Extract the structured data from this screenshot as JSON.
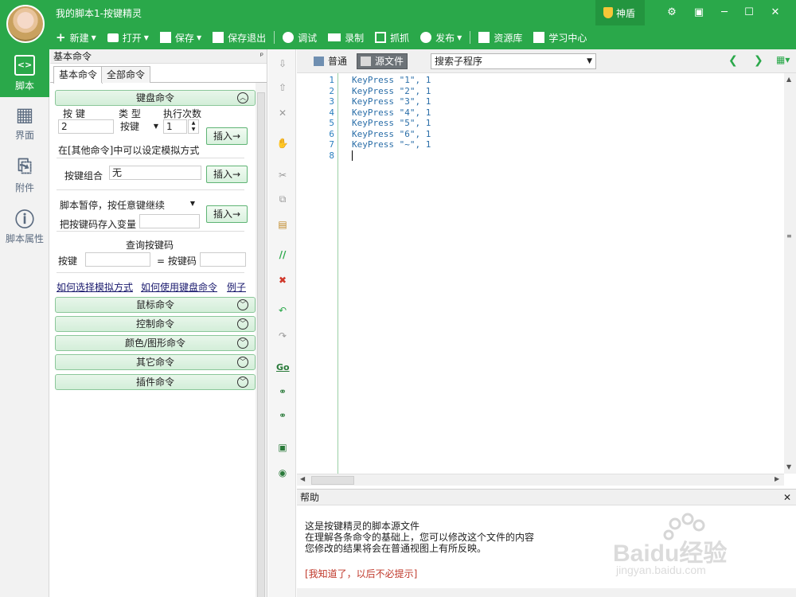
{
  "window": {
    "title": "我的脚本1-按键精灵",
    "shield_label": "神盾",
    "controls": [
      "⚙",
      "▣",
      "─",
      "☐",
      "✕"
    ]
  },
  "toolbar": [
    {
      "label": "新建",
      "caret": true
    },
    {
      "label": "打开",
      "caret": true
    },
    {
      "label": "保存",
      "caret": true
    },
    {
      "label": "保存退出",
      "caret": false
    },
    {
      "label": "调试",
      "caret": false
    },
    {
      "label": "录制",
      "caret": false
    },
    {
      "label": "抓抓",
      "caret": false
    },
    {
      "label": "发布",
      "caret": true
    },
    {
      "label": "资源库",
      "caret": false
    },
    {
      "label": "学习中心",
      "caret": false
    }
  ],
  "leftnav": [
    {
      "label": "脚本",
      "icon": "script-icon",
      "glyph": "<>"
    },
    {
      "label": "界面",
      "icon": "grid-icon",
      "glyph": "▦"
    },
    {
      "label": "附件",
      "icon": "attachment-icon",
      "glyph": "⎘"
    },
    {
      "label": "脚本属性",
      "icon": "info-icon",
      "glyph": "ⓘ"
    }
  ],
  "panel": {
    "header": "基本命令",
    "pin": "ᵖ",
    "tabs": [
      "基本命令",
      "全部命令"
    ],
    "keyboard": {
      "group_title": "键盘命令",
      "key_label": "按 键",
      "type_label": "类 型",
      "count_label": "执行次数",
      "key_value": "2",
      "type_value": "按键",
      "count_value": "1",
      "insert_label": "插入→",
      "note": "在[其他命令]中可以设定模拟方式",
      "combo_label": "按键组合",
      "combo_value": "无",
      "pause_label": "脚本暂停，按任意键继续",
      "store_label": "把按键码存入变量",
      "query_title": "查询按键码",
      "query_key_label": "按键",
      "query_code_label": "= 按键码",
      "links": [
        "如何选择模拟方式",
        "如何使用键盘命令",
        "例子"
      ]
    },
    "groups": [
      "鼠标命令",
      "控制命令",
      "颜色/图形命令",
      "其它命令",
      "插件命令"
    ]
  },
  "editor": {
    "tabs": [
      "普通",
      "源文件"
    ],
    "sub_search": "搜索子程序",
    "lines": [
      {
        "n": "1",
        "code": "KeyPress \"1\", 1"
      },
      {
        "n": "2",
        "code": "KeyPress \"2\", 1"
      },
      {
        "n": "3",
        "code": "KeyPress \"3\", 1"
      },
      {
        "n": "4",
        "code": "KeyPress \"4\", 1"
      },
      {
        "n": "5",
        "code": "KeyPress \"5\", 1"
      },
      {
        "n": "6",
        "code": "KeyPress \"6\", 1"
      },
      {
        "n": "7",
        "code": "KeyPress \"~\", 1"
      },
      {
        "n": "8",
        "code": ""
      }
    ]
  },
  "help": {
    "title": "帮助",
    "lines": [
      "这是按键精灵的脚本源文件",
      "在理解各条命令的基础上，您可以修改这个文件的内容",
      "您修改的结果将会在普通视图上有所反映。"
    ],
    "dismiss": "[我知道了，以后不必提示]"
  },
  "watermark": {
    "brand": "Baidu经验",
    "url": "jingyan.baidu.com"
  }
}
